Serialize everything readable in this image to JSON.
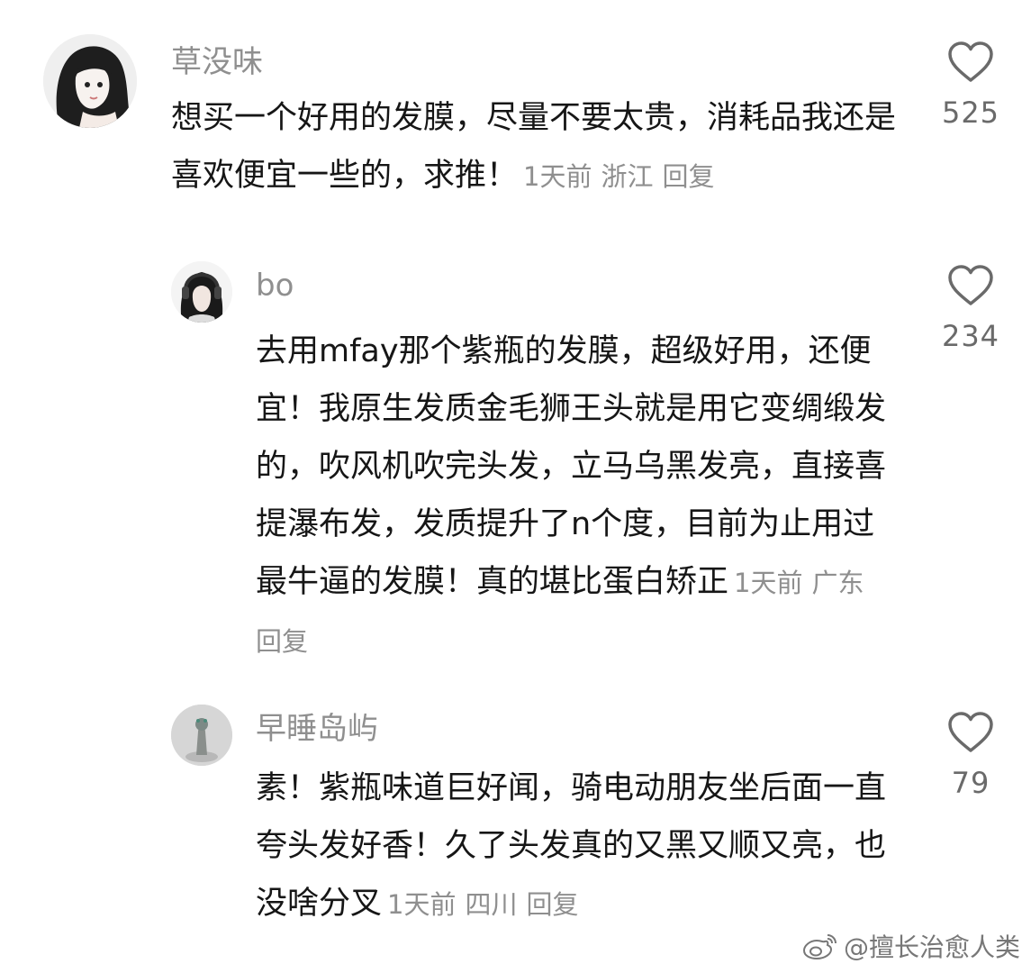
{
  "comments": [
    {
      "username": "草没味",
      "text": "想买一个好用的发膜，尽量不要太贵，消耗品我还是喜欢便宜一些的，求推！",
      "time": "1天前",
      "location": "浙江",
      "reply": "回复",
      "likes": "525"
    },
    {
      "username": "bo",
      "text": "去用mfay那个紫瓶的发膜，超级好用，还便宜！我原生发质金毛狮王头就是用它变绸缎发的，吹风机吹完头发，立马乌黑发亮，直接喜提瀑布发，发质提升了n个度，目前为止用过最牛逼的发膜！真的堪比蛋白矫正",
      "time": "1天前",
      "location": "广东",
      "reply": "回复",
      "likes": "234"
    },
    {
      "username": "早睡岛屿",
      "text": "素！紫瓶味道巨好闻，骑电动朋友坐后面一直夸头发好香！久了头发真的又黑又顺又亮，也没啥分叉",
      "time": "1天前",
      "location": "四川",
      "reply": "回复",
      "likes": "79"
    }
  ],
  "watermark": "@擅长治愈人类"
}
